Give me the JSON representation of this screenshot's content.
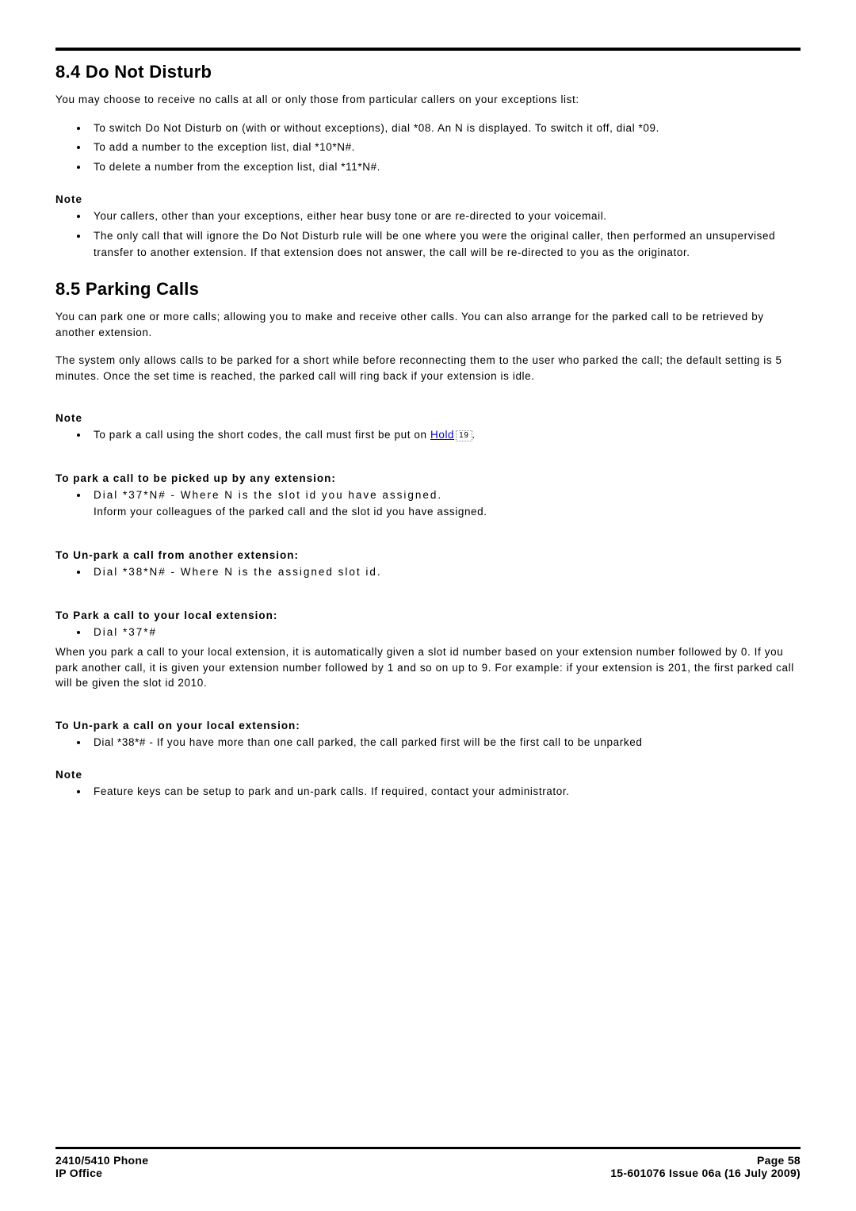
{
  "sections": {
    "dnd": {
      "heading": "8.4 Do Not Disturb",
      "intro": "You may choose to receive no calls at all or only those from particular callers on your exceptions list:",
      "list1": [
        "To switch Do Not Disturb on (with or without exceptions), dial *08. An N is displayed. To switch it off, dial *09.",
        "To add a number to the exception list, dial *10*N#.",
        "To delete a number from the exception list, dial *11*N#."
      ],
      "note_label": "Note",
      "notes": [
        "Your callers, other than your exceptions, either hear busy tone or are re-directed to your voicemail.",
        "The only call that will ignore the Do Not Disturb rule will be one where you were the original caller, then performed an unsupervised transfer to another extension. If that extension does not answer, the call will be re-directed to you as the originator."
      ]
    },
    "parking": {
      "heading": "8.5 Parking Calls",
      "intro1": "You can park one or more calls; allowing you to make and receive other calls. You can also arrange for the parked call to be retrieved by another extension.",
      "intro2": "The system only allows calls to be parked for a short while before reconnecting them to the user who parked the call; the default setting is 5 minutes. Once the set time is reached, the parked call will ring back if your extension is idle.",
      "note_label": "Note",
      "note_prefix": "To park a call using the short codes, the call must first be put on ",
      "hold_link": "Hold",
      "hold_ref": "19",
      "note_suffix": ".",
      "pickup_any_label": "To park a call to be picked up by any extension:",
      "pickup_any_line1": "Dial *37*N#  -  Where N is the slot id you have assigned.",
      "pickup_any_line2": "Inform your colleagues of the parked call and the slot id you have assigned.",
      "unpark_other_label": "To Un-park a call from another extension:",
      "unpark_other_item": "Dial *38*N#  -  Where N is the assigned slot id.",
      "park_local_label": "To Park a call to your local extension:",
      "park_local_item": "Dial *37*#",
      "park_local_para": "When you park a call to your local extension, it is automatically given a slot id number based on your extension number followed by 0. If you park another call, it is given your extension number followed by 1 and so on up to 9. For example: if your extension is 201, the first parked call will be given the slot id 2010.",
      "unpark_local_label": "To Un-park a call on your local extension:",
      "unpark_local_item": "Dial *38*# - If you have more than one call parked, the call parked first will be the first call to be unparked",
      "note2_label": "Note",
      "note2_item": "Feature keys can be setup to park and un-park calls. If required, contact your administrator."
    }
  },
  "footer": {
    "left1": "2410/5410 Phone",
    "left2": "IP Office",
    "right1": "Page 58",
    "right2": "15-601076 Issue 06a (16 July 2009)"
  }
}
